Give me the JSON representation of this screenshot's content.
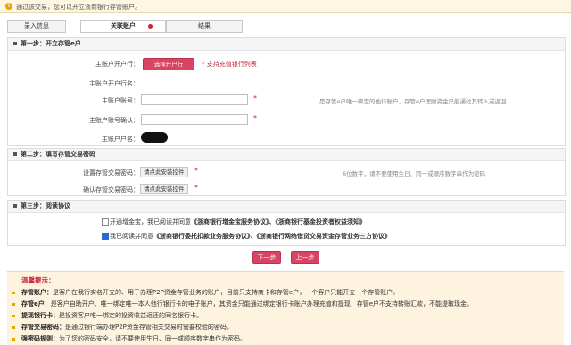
{
  "notice": {
    "text": "通过该交易，您可以开立浙商银行存管账户。"
  },
  "steps": [
    {
      "label": "录入信息"
    },
    {
      "label": "关联账户"
    },
    {
      "label": "结果"
    }
  ],
  "section1": {
    "title": "第一步：开立存管e户",
    "bank_label": "主账户开户行：",
    "select_bank_button": "选择开户行",
    "support_link": "* 支持充值银行列表",
    "bank_name_label": "主账户开户行名：",
    "account_label": "主账户账号：",
    "account_confirm_label": "主账户账号确认：",
    "account_hint": "是存管e户唯一绑定的他行账户，存管e户理财资金只能通过其转入或返回",
    "owner_label": "主账户户名："
  },
  "section2": {
    "title": "第二步：填写存管交易密码",
    "pwd_label": "设置存管交易密码：",
    "pwd_confirm_label": "确认存管交易密码：",
    "install_control": "请点此安装控件",
    "pwd_hint": "6位数字，请不要使用生日、同一或顺序数字串作为密码"
  },
  "section3": {
    "title": "第三步：阅读协议",
    "agree1_prefix": "开通增金宝，我已阅读并同意",
    "agree1_doc1": "《浙商银行增金宝服务协议》、",
    "agree1_doc2": "《浙商银行基金投资者权益须知》",
    "agree1_checked": false,
    "agree2_prefix": "我已阅读并同意",
    "agree2_doc1": "《浙商银行委托扣款业务服务协议》、",
    "agree2_doc2": "《浙商银行网络借贷交易资金存管业务三方协议》",
    "agree2_checked": true
  },
  "actions": {
    "next": "下一步",
    "prev": "上一步"
  },
  "tips": {
    "title": "温馨提示：",
    "items": [
      {
        "term": "存管账户：",
        "text": "是客户在我行实名开立的、用于办理P2P资金存管业务的账户，目前只支持商卡和存管e户，一个客户只能开立一个存管账户。"
      },
      {
        "term": "存管e户：",
        "text": "是客户自助开户、唯一绑定唯一本人他行银行卡的电子账户，其资金只能通过绑定银行卡账户办理充值和提现，存管e户不支持转账汇款，不能提取现金。"
      },
      {
        "term": "提现银行卡：",
        "text": "是投资客户唯一绑定的投资收益返还的同名银行卡。"
      },
      {
        "term": "存管交易密码：",
        "text": "是通过银行端办理P2P资金存管相关交易时需要校验的密码。"
      },
      {
        "term": "强密码规则：",
        "text": "为了您的密码安全，请不要使用生日、同一或顺序数字串作为密码。"
      }
    ]
  },
  "colors": {
    "accent": "#d94465",
    "required": "#d21d3b",
    "tips_bg": "#fdf3df"
  }
}
